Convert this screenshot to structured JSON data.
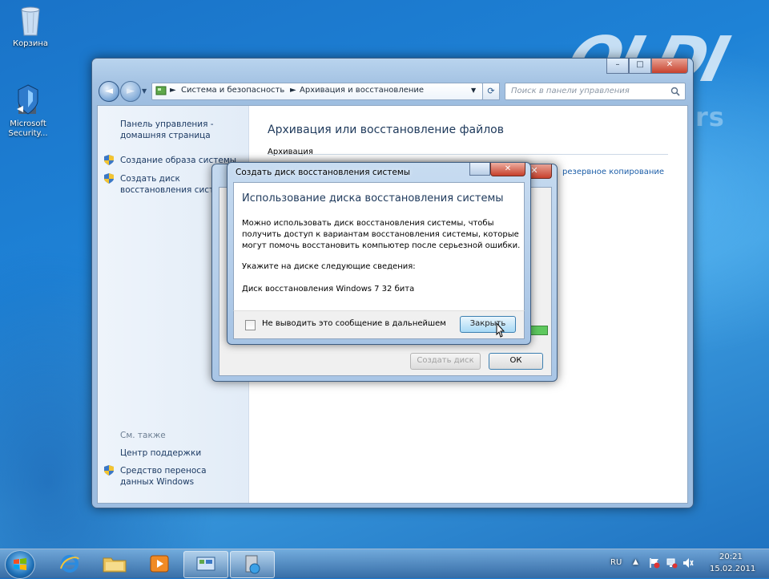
{
  "desktop": {
    "icons": [
      {
        "label": "Корзина"
      },
      {
        "label": "Microsoft Security..."
      }
    ],
    "watermark": {
      "line1": "OLDI",
      "line2": "computers"
    }
  },
  "window": {
    "breadcrumb": [
      "Система и безопасность",
      "Архивация и восстановление"
    ],
    "search_placeholder": "Поиск в панели управления",
    "sidebar": {
      "home": [
        "Панель управления -",
        "домашняя страница"
      ],
      "links": [
        {
          "label": "Создание образа системы"
        },
        {
          "label": "Создать диск восстановления системы"
        }
      ],
      "see_also_title": "См. также",
      "see_also": [
        {
          "label": "Центр поддержки"
        },
        {
          "label": "Средство переноса данных Windows"
        }
      ]
    },
    "main": {
      "title": "Архивация или восстановление файлов",
      "section": "Архивация",
      "link": "резервное копирование"
    }
  },
  "outer_dialog": {
    "title": "Создать диск восстановления системы",
    "create_button": "Создать диск",
    "ok_button": "ОК"
  },
  "inner_dialog": {
    "title": "Создать диск восстановления системы",
    "heading": "Использование диска восстановления системы",
    "description": [
      "Можно использовать диск восстановления системы, чтобы",
      "получить доступ к вариантам восстановления системы, которые",
      "могут помочь восстановить компьютер после серьезной ошибки."
    ],
    "info_label": "Укажите на диске следующие сведения:",
    "info_value": "Диск восстановления Windows 7 32 бита",
    "checkbox_label": "Не выводить это сообщение в дальнейшем",
    "close_button": "Закрыть"
  },
  "taskbar": {
    "lang": "RU",
    "time": "20:21",
    "date": "15.02.2011"
  }
}
